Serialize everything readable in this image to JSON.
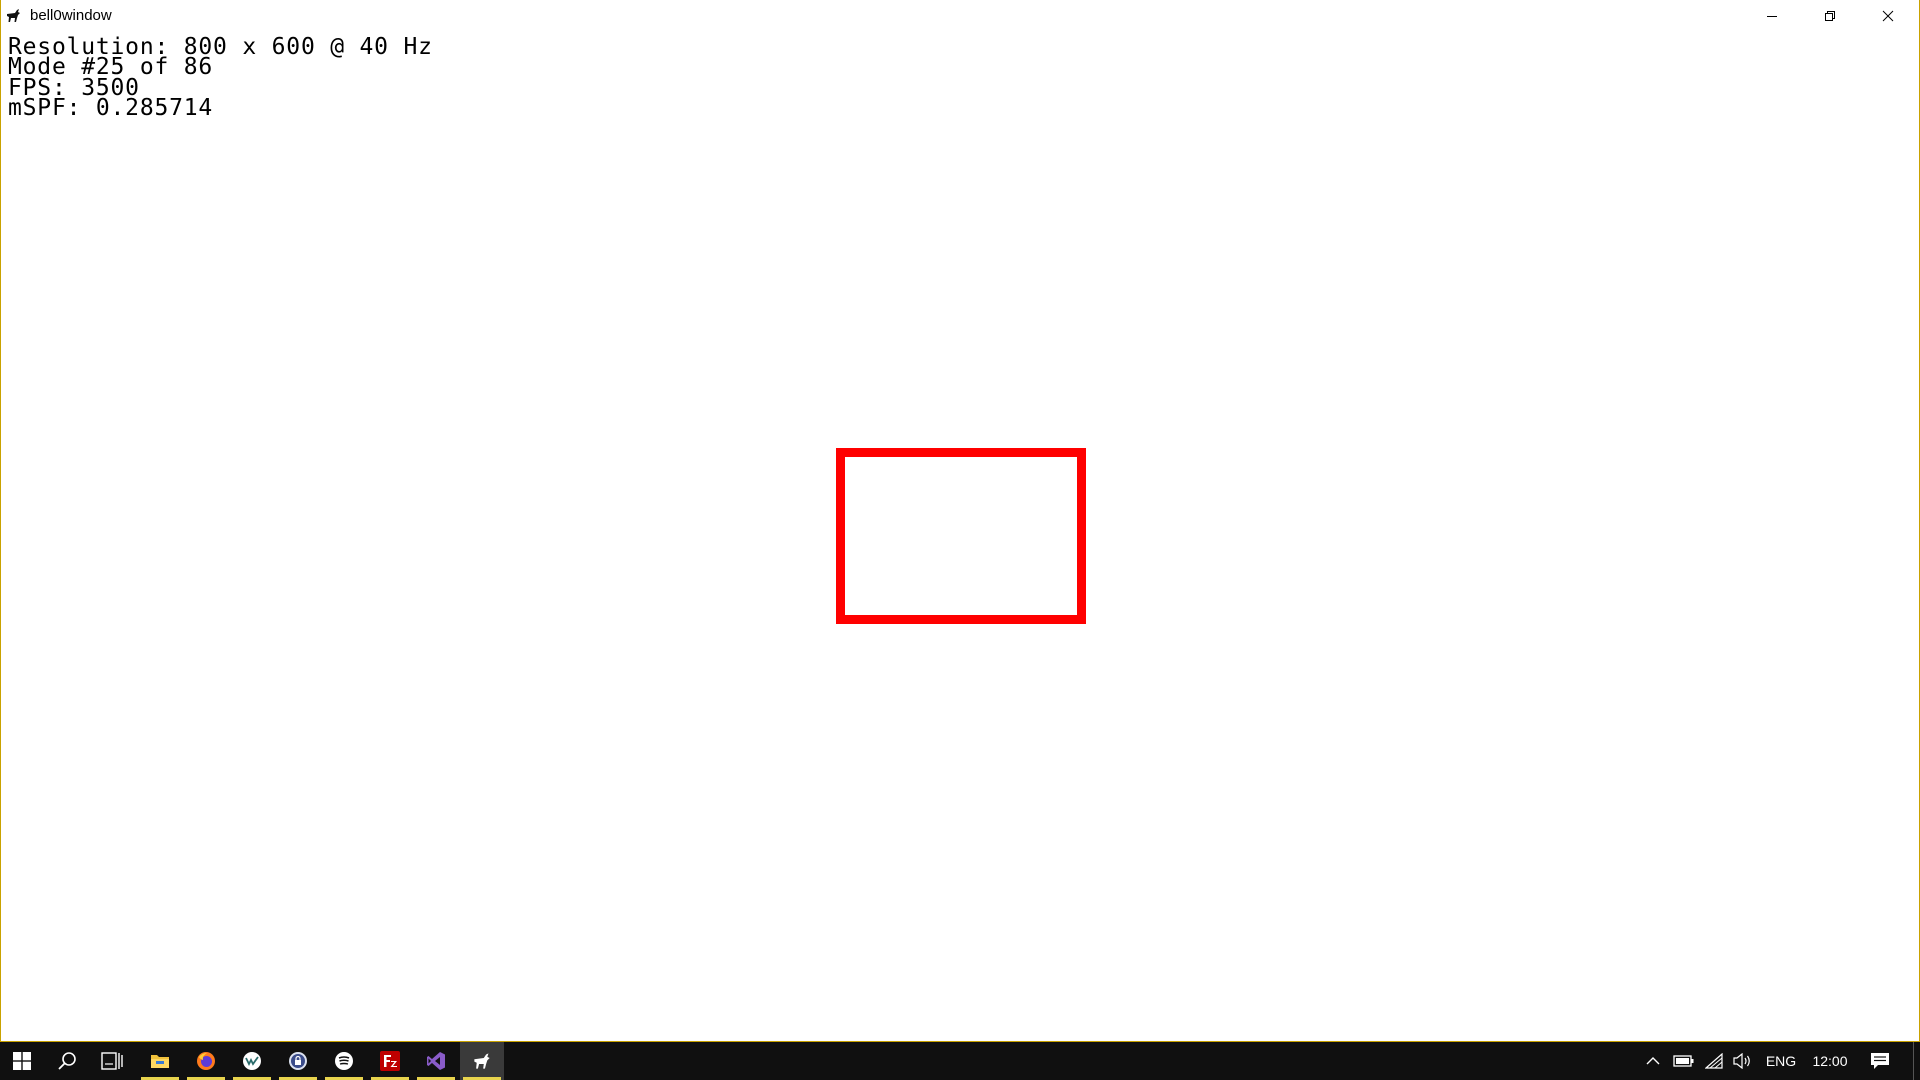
{
  "window": {
    "title": "bell0window",
    "app_icon": "goat-icon",
    "controls": {
      "minimize_icon": "minimize-icon",
      "maximize_icon": "restore-icon",
      "close_icon": "close-icon"
    },
    "border_color": "#c9a200"
  },
  "client": {
    "stats": [
      "Resolution: 800 x 600 @ 40 Hz",
      "Mode #25 of 86",
      "FPS: 3500",
      "mSPF: 0.285714"
    ],
    "rectangle_color": "#ff0000"
  },
  "taskbar": {
    "items": [
      {
        "name": "start-button",
        "icon": "windows-icon"
      },
      {
        "name": "search-button",
        "icon": "search-icon"
      },
      {
        "name": "task-view-button",
        "icon": "task-view-icon"
      },
      {
        "name": "file-explorer",
        "icon": "folder-icon"
      },
      {
        "name": "firefox",
        "icon": "firefox-icon"
      },
      {
        "name": "app-vk",
        "icon": "vk-icon"
      },
      {
        "name": "app-keepass",
        "icon": "lock-icon"
      },
      {
        "name": "app-music",
        "icon": "music-icon"
      },
      {
        "name": "filezilla",
        "icon": "filezilla-icon"
      },
      {
        "name": "visual-studio",
        "icon": "visual-studio-icon"
      },
      {
        "name": "bell0window-task",
        "icon": "goat-icon"
      }
    ],
    "tray": {
      "language": "ENG",
      "clock": "12:00",
      "icons": [
        "chevron-up-icon",
        "battery-icon",
        "wifi-icon",
        "volume-icon",
        "notification-icon"
      ]
    },
    "accent_color": "#e8d44d"
  }
}
